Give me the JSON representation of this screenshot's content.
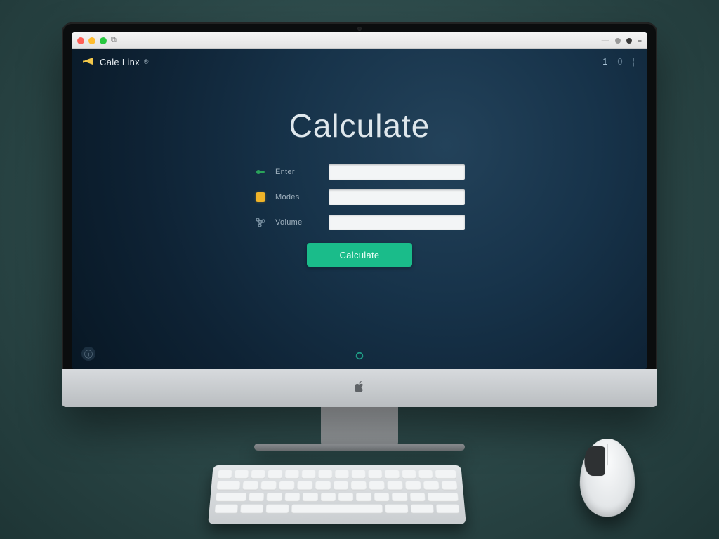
{
  "brand": {
    "name": "Cale Linx",
    "reg": "®"
  },
  "topright": {
    "a": "1",
    "b": "0"
  },
  "hero": {
    "title": "Calculate"
  },
  "form": {
    "rows": [
      {
        "label": "Enter",
        "value": "",
        "placeholder": ""
      },
      {
        "label": "Modes",
        "value": "",
        "placeholder": ""
      },
      {
        "label": "Volume",
        "value": "",
        "placeholder": ""
      }
    ],
    "submit": "Calculate"
  },
  "icons": {
    "brand": "megaphone-icon",
    "row0": "key-icon",
    "row1": "note-icon",
    "row2": "nodes-icon",
    "footer_left": "info-icon",
    "footer_center": "ring-icon"
  },
  "colors": {
    "accent": "#1abc8a",
    "bg_app": "#12304a",
    "bg_desk": "#2d4a4a"
  }
}
